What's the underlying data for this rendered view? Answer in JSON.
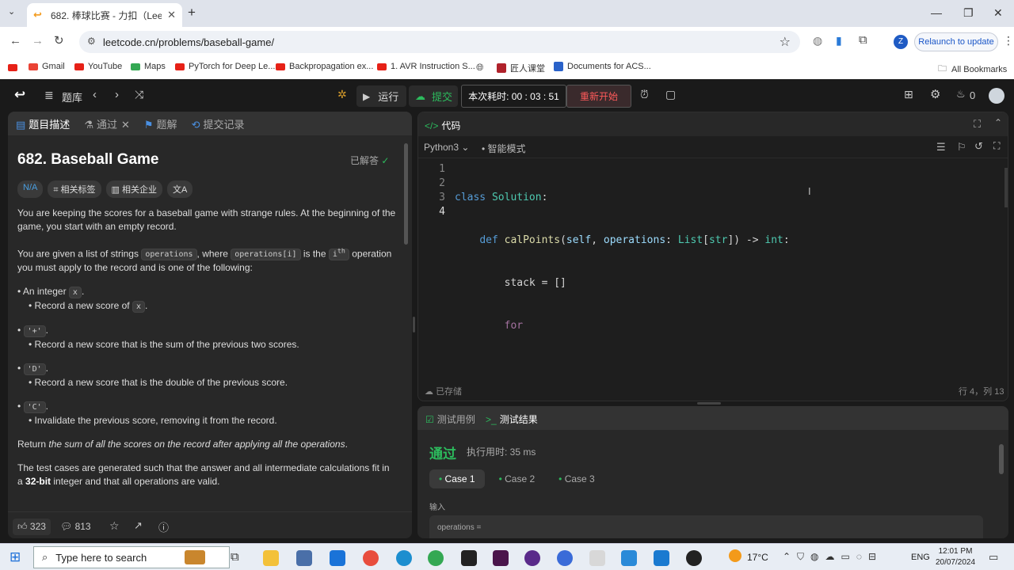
{
  "browser": {
    "tab_title": "682. 棒球比赛 - 力扣（LeetCod",
    "url": "leetcode.cn/problems/baseball-game/",
    "relaunch": "Relaunch to update",
    "profile_initial": "Z",
    "bookmarks": [
      "Gmail",
      "YouTube",
      "Maps",
      "PyTorch for Deep Le...",
      "Backpropagation ex...",
      "1. AVR Instruction S...",
      "匠人课堂",
      "Documents for ACS..."
    ],
    "all_bookmarks": "All Bookmarks",
    "colors": {
      "youtube": "#e62117",
      "gmail": "#ea4335",
      "maps": "#34a853"
    }
  },
  "nav": {
    "problem_list": "题库",
    "run": "运行",
    "submit": "提交",
    "timer": "本次耗时: 00 : 03 : 51",
    "restart": "重新开始",
    "points": "0"
  },
  "left": {
    "tabs": [
      "题目描述",
      "通过",
      "题解",
      "提交记录"
    ],
    "title": "682. Baseball Game",
    "solved": "已解答",
    "tags": [
      "N/A",
      "相关标签",
      "相关企业"
    ],
    "para1": "You are keeping the scores for a baseball game with strange rules. At the beginning of the game, you start with an empty record.",
    "para2_a": "You are given a list of strings ",
    "para2_code1": "operations",
    "para2_b": ", where ",
    "para2_code2": "operations[i]",
    "para2_c": " is the ",
    "para2_code3": "i",
    "para2_sup": "th",
    "para2_d": " operation you must apply to the record and is one of the following:",
    "items": [
      {
        "head": "An integer ",
        "code": "x",
        "tail": ".",
        "sub": "Record a new score of ",
        "subcode": "x",
        "subtail": "."
      },
      {
        "head": "",
        "code": "'+'",
        "tail": ".",
        "sub": "Record a new score that is the sum of the previous two scores.",
        "subcode": "",
        "subtail": ""
      },
      {
        "head": "",
        "code": "'D'",
        "tail": ".",
        "sub": "Record a new score that is the double of the previous score.",
        "subcode": "",
        "subtail": ""
      },
      {
        "head": "",
        "code": "'C'",
        "tail": ".",
        "sub": "Invalidate the previous score, removing it from the record.",
        "subcode": "",
        "subtail": ""
      }
    ],
    "para3_a": "Return ",
    "para3_em": "the sum of all the scores on the record after applying all the operations",
    "para3_b": ".",
    "para4_a": "The test cases are generated such that the answer and all intermediate calculations fit in a ",
    "para4_bold": "32-bit",
    "para4_b": " integer and that all operations are valid.",
    "likes": "323",
    "comments": "813"
  },
  "editor": {
    "tab": "代码",
    "lang": "Python3",
    "mode": "智能模式",
    "line_numbers": [
      "1",
      "2",
      "3",
      "4"
    ],
    "saved": "已存储",
    "cursor": "行 4，列 13"
  },
  "result": {
    "tabs": [
      "测试用例",
      "测试结果"
    ],
    "status": "通过",
    "runtime": "执行用时: 35 ms",
    "cases": [
      "Case 1",
      "Case 2",
      "Case 3"
    ],
    "input_label": "输入",
    "input_var": "operations ="
  },
  "taskbar": {
    "search": "Type here to search",
    "temp": "17°C",
    "lang": "ENG",
    "time": "12:01 PM",
    "date": "20/07/2024"
  }
}
